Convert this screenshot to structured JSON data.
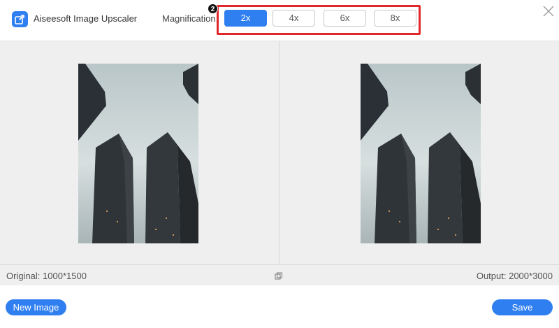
{
  "app": {
    "title": "Aiseesoft Image Upscaler",
    "logo_icon": "image-upscale-icon",
    "accent_color": "#2f7ff1"
  },
  "magnification": {
    "label": "Magnification:",
    "options": [
      "2x",
      "4x",
      "6x",
      "8x"
    ],
    "selected": "2x",
    "step_badge": "2",
    "highlight_color": "#e0272a"
  },
  "preview": {
    "original_label": "Original: 1000*1500",
    "output_label": "Output: 2000*3000",
    "compare_icon": "compare-icon"
  },
  "footer": {
    "new_image_label": "New Image",
    "save_label": "Save"
  },
  "window": {
    "close_icon": "close-icon"
  }
}
